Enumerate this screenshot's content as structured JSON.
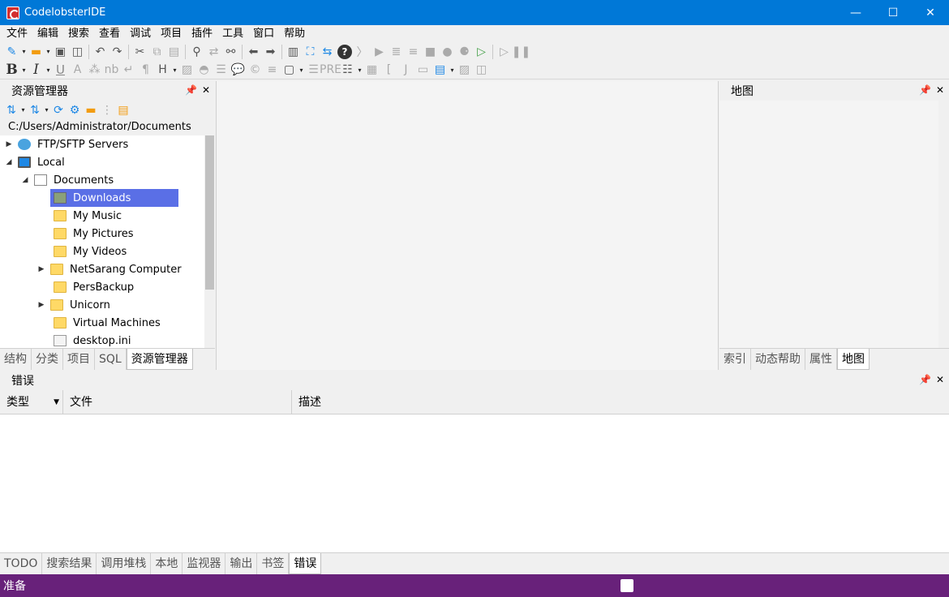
{
  "window": {
    "title": "CodelobsterIDE",
    "minimize": "—",
    "maximize": "☐",
    "close": "✕"
  },
  "menubar": [
    "文件",
    "编辑",
    "搜索",
    "查看",
    "调试",
    "项目",
    "插件",
    "工具",
    "窗口",
    "帮助"
  ],
  "explorer": {
    "title": "资源管理器",
    "pin": "📌",
    "close": "✕",
    "path": "C:/Users/Administrator/Documents",
    "tree": [
      {
        "label": "FTP/SFTP Servers",
        "expander": "▶",
        "icon": "globe-icon"
      },
      {
        "label": "Local",
        "expander": "◢",
        "icon": "monitor-icon"
      },
      {
        "label": "Documents",
        "expander": "◢",
        "icon": "document-icon"
      },
      {
        "label": "Downloads",
        "expander": "",
        "icon": "folder-icon"
      },
      {
        "label": "My Music",
        "expander": "",
        "icon": "folder-icon"
      },
      {
        "label": "My Pictures",
        "expander": "",
        "icon": "folder-icon"
      },
      {
        "label": "My Videos",
        "expander": "",
        "icon": "folder-icon"
      },
      {
        "label": "NetSarang Computer",
        "expander": "▶",
        "icon": "folder-icon"
      },
      {
        "label": "PersBackup",
        "expander": "",
        "icon": "folder-icon"
      },
      {
        "label": "Unicorn",
        "expander": "▶",
        "icon": "folder-icon"
      },
      {
        "label": "Virtual Machines",
        "expander": "",
        "icon": "folder-icon"
      },
      {
        "label": "desktop.ini",
        "expander": "",
        "icon": "settings-file-icon"
      }
    ],
    "tabs": [
      "结构",
      "分类",
      "项目",
      "SQL",
      "资源管理器"
    ]
  },
  "mappanel": {
    "title": "地图",
    "pin": "📌",
    "close": "✕",
    "tabs": [
      "索引",
      "动态帮助",
      "属性",
      "地图"
    ]
  },
  "errors": {
    "title": "错误",
    "pin": "📌",
    "close": "✕",
    "columns": [
      "类型",
      "文件",
      "描述"
    ],
    "sort_arrow": "▼",
    "tabs": [
      "TODO",
      "搜索结果",
      "调用堆栈",
      "本地",
      "监视器",
      "输出",
      "书签",
      "错误"
    ]
  },
  "toolbar_text": {
    "bold": "B",
    "italic": "I",
    "underline": "U",
    "font": "A",
    "nb": "nb",
    "pilcrow": "¶",
    "heading": "H",
    "pre": "PRE",
    "j": "J",
    "help": "?",
    "dropdown": "▾"
  },
  "status": {
    "text": "准备"
  },
  "colors": {
    "titlebar": "#0078d7",
    "statusbar": "#68217a",
    "selection": "#5a6fe6"
  }
}
